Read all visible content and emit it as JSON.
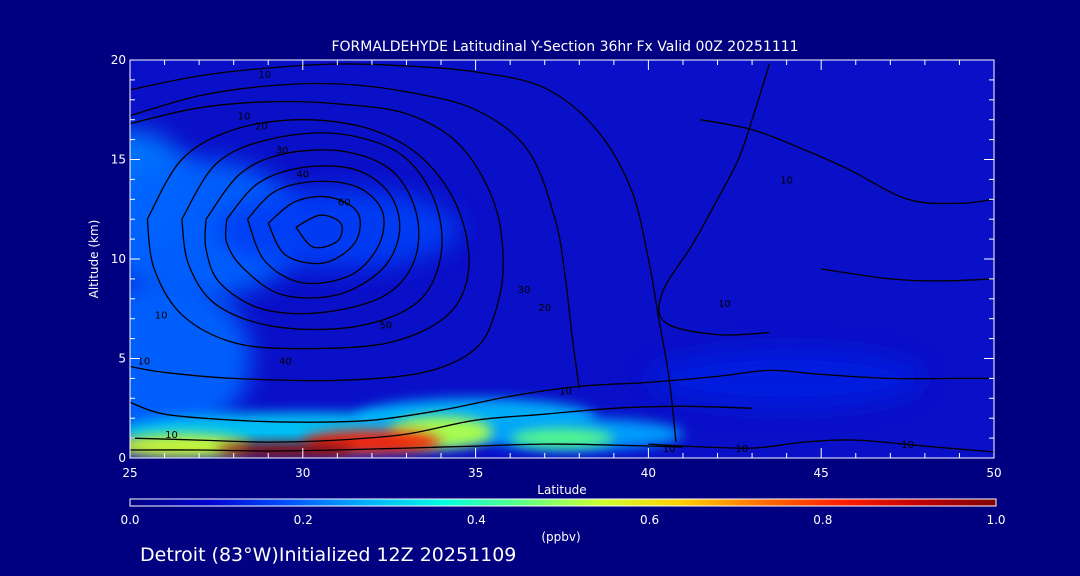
{
  "colors": {
    "background": "#000080",
    "contour": "#000000",
    "text": "#ffffff",
    "colorbar_stops": [
      "#000080",
      "#0000d0",
      "#0050ff",
      "#00b0ff",
      "#00ffe0",
      "#60ff80",
      "#d0ff30",
      "#ffd000",
      "#ff7000",
      "#ff2000",
      "#c00000",
      "#800000"
    ]
  },
  "footer": {
    "text": "Detroit (83°W)Initialized 12Z 20251109"
  },
  "chart_data": {
    "type": "heatmap",
    "title": "FORMALDEHYDE Latitudinal Y-Section 36hr  Fx Valid 00Z 20251111",
    "xlabel": "Latitude",
    "ylabel": "Altitude (km)",
    "xlim": [
      25,
      50
    ],
    "ylim": [
      0,
      20
    ],
    "x_ticks": [
      "25",
      "30",
      "35",
      "40",
      "45",
      "50"
    ],
    "y_ticks": [
      "0",
      "5",
      "10",
      "15",
      "20"
    ],
    "grid": false,
    "colorbar": {
      "label": "(ppbv)",
      "range": [
        0.0,
        1.0
      ],
      "tick_labels": [
        "0.0",
        "0.2",
        "0.4",
        "0.6",
        "0.8",
        "1.0"
      ]
    },
    "heat_blobs": [
      {
        "x": 25.0,
        "y": 13.5,
        "rx": 1.8,
        "ry": 3.0,
        "v": 0.22
      },
      {
        "x": 27.0,
        "y": 11.5,
        "rx": 3.0,
        "ry": 3.5,
        "v": 0.2
      },
      {
        "x": 31.0,
        "y": 11.5,
        "rx": 3.5,
        "ry": 2.0,
        "v": 0.16
      },
      {
        "x": 26.0,
        "y": 5.0,
        "rx": 2.5,
        "ry": 4.0,
        "v": 0.2
      },
      {
        "x": 30.0,
        "y": 1.3,
        "rx": 5.5,
        "ry": 1.0,
        "v": 0.3
      },
      {
        "x": 35.0,
        "y": 2.0,
        "rx": 3.5,
        "ry": 1.0,
        "v": 0.28
      },
      {
        "x": 38.0,
        "y": 1.2,
        "rx": 3.0,
        "ry": 0.8,
        "v": 0.26
      },
      {
        "x": 44.0,
        "y": 4.0,
        "rx": 4.0,
        "ry": 1.5,
        "v": 0.12
      },
      {
        "x": 26.5,
        "y": 0.6,
        "rx": 2.0,
        "ry": 0.6,
        "v": 0.55
      },
      {
        "x": 34.0,
        "y": 1.3,
        "rx": 1.5,
        "ry": 0.8,
        "v": 0.52
      },
      {
        "x": 37.5,
        "y": 1.0,
        "rx": 1.5,
        "ry": 0.5,
        "v": 0.45
      },
      {
        "x": 32.0,
        "y": 0.8,
        "rx": 2.0,
        "ry": 0.6,
        "v": 0.82
      },
      {
        "x": 29.5,
        "y": 0.4,
        "rx": 2.0,
        "ry": 0.4,
        "v": 0.97
      }
    ],
    "contours": [
      {
        "points": [
          [
            25,
            18.5
          ],
          [
            27,
            19.2
          ],
          [
            29,
            19.6
          ],
          [
            31,
            19.8
          ],
          [
            33,
            19.7
          ],
          [
            35,
            19.4
          ],
          [
            37,
            18.6
          ],
          [
            38.5,
            16.5
          ],
          [
            39.5,
            13.5
          ],
          [
            40,
            10
          ],
          [
            40.3,
            7
          ],
          [
            40.6,
            4
          ],
          [
            40.8,
            0.8
          ]
        ]
      },
      {
        "points": [
          [
            25,
            17.2
          ],
          [
            27,
            18.2
          ],
          [
            29,
            18.7
          ],
          [
            31,
            18.8
          ],
          [
            33,
            18.4
          ],
          [
            35,
            17.5
          ],
          [
            36.5,
            15.5
          ],
          [
            37.3,
            12
          ],
          [
            37.6,
            9
          ],
          [
            37.8,
            6
          ],
          [
            38,
            3.5
          ]
        ]
      },
      {
        "points": [
          [
            25,
            16.8
          ],
          [
            27,
            17.6
          ],
          [
            29,
            17.9
          ],
          [
            31,
            17.8
          ],
          [
            33,
            17.3
          ],
          [
            34.5,
            15.8
          ],
          [
            35.5,
            13
          ],
          [
            35.8,
            10
          ],
          [
            35.6,
            7.5
          ],
          [
            35,
            5.5
          ],
          [
            33.5,
            4.3
          ],
          [
            31,
            3.9
          ],
          [
            28,
            4.0
          ],
          [
            26,
            4.3
          ],
          [
            25,
            4.6
          ]
        ]
      },
      {
        "points": [
          [
            25.5,
            12
          ],
          [
            26.5,
            15
          ],
          [
            28,
            16.5
          ],
          [
            30,
            17
          ],
          [
            32,
            16.5
          ],
          [
            33.5,
            15
          ],
          [
            34.5,
            12.5
          ],
          [
            34.8,
            9.5
          ],
          [
            34.2,
            7.2
          ],
          [
            32.5,
            5.8
          ],
          [
            30,
            5.5
          ],
          [
            28,
            5.8
          ],
          [
            26.5,
            7.2
          ],
          [
            25.7,
            9.5
          ],
          [
            25.5,
            12
          ]
        ]
      },
      {
        "points": [
          [
            26.5,
            12
          ],
          [
            27.5,
            14.8
          ],
          [
            29,
            16
          ],
          [
            31,
            16.3
          ],
          [
            32.8,
            15.3
          ],
          [
            33.8,
            13
          ],
          [
            34,
            10.2
          ],
          [
            33.3,
            7.8
          ],
          [
            31.5,
            6.6
          ],
          [
            29.2,
            6.6
          ],
          [
            27.5,
            7.7
          ],
          [
            26.7,
            9.7
          ],
          [
            26.5,
            12
          ]
        ]
      },
      {
        "points": [
          [
            27.2,
            12
          ],
          [
            28.2,
            14.3
          ],
          [
            29.5,
            15.3
          ],
          [
            31.2,
            15.4
          ],
          [
            32.6,
            14.4
          ],
          [
            33.3,
            12.2
          ],
          [
            33.2,
            9.8
          ],
          [
            32.3,
            8.1
          ],
          [
            30.5,
            7.3
          ],
          [
            28.8,
            7.5
          ],
          [
            27.6,
            8.8
          ],
          [
            27.2,
            10.5
          ],
          [
            27.2,
            12
          ]
        ]
      },
      {
        "points": [
          [
            27.8,
            12
          ],
          [
            28.7,
            13.8
          ],
          [
            30,
            14.6
          ],
          [
            31.5,
            14.5
          ],
          [
            32.5,
            13.3
          ],
          [
            32.8,
            11.4
          ],
          [
            32.3,
            9.5
          ],
          [
            31,
            8.2
          ],
          [
            29.4,
            8.2
          ],
          [
            28.3,
            9.5
          ],
          [
            27.8,
            10.8
          ],
          [
            27.8,
            12
          ]
        ]
      },
      {
        "points": [
          [
            28.4,
            12
          ],
          [
            29.2,
            13.4
          ],
          [
            30.4,
            13.9
          ],
          [
            31.6,
            13.6
          ],
          [
            32.3,
            12.4
          ],
          [
            32.2,
            10.7
          ],
          [
            31.4,
            9.2
          ],
          [
            30,
            8.8
          ],
          [
            28.9,
            9.9
          ],
          [
            28.4,
            12
          ]
        ]
      },
      {
        "points": [
          [
            29,
            11.8
          ],
          [
            29.8,
            12.9
          ],
          [
            30.8,
            13.1
          ],
          [
            31.6,
            12.3
          ],
          [
            31.5,
            10.8
          ],
          [
            30.6,
            9.8
          ],
          [
            29.5,
            10.2
          ],
          [
            29,
            11.8
          ]
        ]
      },
      {
        "points": [
          [
            29.8,
            11.6
          ],
          [
            30.5,
            12.2
          ],
          [
            31.1,
            11.8
          ],
          [
            31,
            10.9
          ],
          [
            30.3,
            10.6
          ],
          [
            29.8,
            11.6
          ]
        ]
      },
      {
        "points": [
          [
            41.5,
            17
          ],
          [
            43,
            16.5
          ],
          [
            44.5,
            15.5
          ],
          [
            45.8,
            14.5
          ],
          [
            47.5,
            13
          ],
          [
            49,
            12.8
          ],
          [
            50,
            13
          ]
        ]
      },
      {
        "points": [
          [
            43.5,
            19.8
          ],
          [
            43,
            17
          ],
          [
            42.6,
            15
          ],
          [
            42,
            13
          ],
          [
            41.3,
            10.8
          ],
          [
            40.4,
            8.3
          ],
          [
            40.5,
            6.8
          ],
          [
            42,
            6.2
          ],
          [
            43.5,
            6.3
          ]
        ]
      },
      {
        "points": [
          [
            45,
            9.5
          ],
          [
            47,
            9.0
          ],
          [
            48.5,
            8.9
          ],
          [
            50,
            9.0
          ]
        ]
      },
      {
        "points": [
          [
            25,
            2.8
          ],
          [
            26,
            2.2
          ],
          [
            28,
            1.9
          ],
          [
            30,
            1.8
          ],
          [
            32,
            1.9
          ],
          [
            34,
            2.4
          ],
          [
            36,
            3.1
          ],
          [
            38,
            3.6
          ],
          [
            40,
            3.8
          ],
          [
            42,
            4.1
          ],
          [
            43.5,
            4.4
          ],
          [
            45,
            4.2
          ],
          [
            47,
            4.0
          ],
          [
            49,
            4.0
          ],
          [
            50,
            4.0
          ]
        ]
      },
      {
        "points": [
          [
            25,
            1.0
          ],
          [
            27,
            0.9
          ],
          [
            29,
            0.8
          ],
          [
            31,
            0.9
          ],
          [
            33,
            1.2
          ],
          [
            35,
            1.9
          ],
          [
            37,
            2.2
          ],
          [
            39,
            2.5
          ],
          [
            41,
            2.6
          ],
          [
            43,
            2.5
          ]
        ]
      },
      {
        "points": [
          [
            40,
            0.7
          ],
          [
            41,
            0.6
          ],
          [
            43,
            0.5
          ],
          [
            44.5,
            0.8
          ],
          [
            46,
            0.9
          ],
          [
            48,
            0.6
          ],
          [
            50,
            0.3
          ]
        ]
      },
      {
        "points": [
          [
            25,
            0.4
          ],
          [
            27,
            0.4
          ],
          [
            29,
            0.35
          ],
          [
            31,
            0.4
          ],
          [
            33,
            0.5
          ],
          [
            35,
            0.6
          ],
          [
            37,
            0.7
          ],
          [
            39,
            0.65
          ],
          [
            41,
            0.55
          ]
        ]
      }
    ],
    "contour_labels": [
      {
        "text": "10",
        "x": 28.9,
        "y": 19.3
      },
      {
        "text": "10",
        "x": 28.3,
        "y": 17.2
      },
      {
        "text": "20",
        "x": 28.8,
        "y": 16.7
      },
      {
        "text": "30",
        "x": 29.4,
        "y": 15.5
      },
      {
        "text": "40",
        "x": 30.0,
        "y": 14.3
      },
      {
        "text": "60",
        "x": 31.2,
        "y": 12.9
      },
      {
        "text": "30",
        "x": 36.4,
        "y": 8.5
      },
      {
        "text": "20",
        "x": 37.0,
        "y": 7.6
      },
      {
        "text": "50",
        "x": 32.4,
        "y": 6.7
      },
      {
        "text": "40",
        "x": 29.5,
        "y": 4.9
      },
      {
        "text": "10",
        "x": 25.9,
        "y": 7.2
      },
      {
        "text": "10",
        "x": 25.4,
        "y": 4.9
      },
      {
        "text": "10",
        "x": 37.6,
        "y": 3.4
      },
      {
        "text": "10",
        "x": 26.2,
        "y": 1.2
      },
      {
        "text": "10",
        "x": 40.6,
        "y": 0.5
      },
      {
        "text": "10",
        "x": 42.7,
        "y": 0.5
      },
      {
        "text": "10",
        "x": 47.5,
        "y": 0.7
      },
      {
        "text": "10",
        "x": 42.2,
        "y": 7.8
      },
      {
        "text": "10",
        "x": 44.0,
        "y": 14.0
      }
    ]
  }
}
